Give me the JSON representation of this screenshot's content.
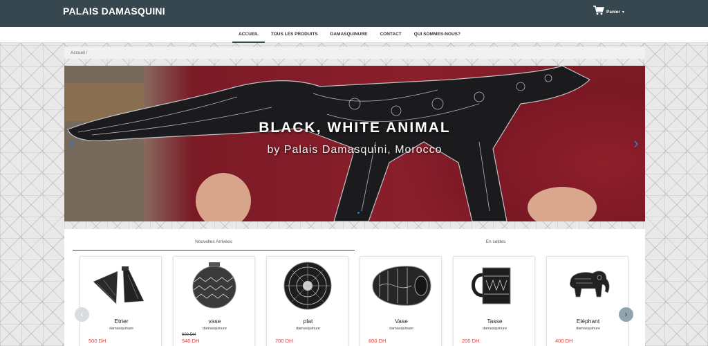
{
  "header": {
    "brand": "PALAIS DAMASQUINI",
    "cart_label": "Panier",
    "cart_caret": "▾"
  },
  "nav": {
    "items": [
      {
        "label": "ACCUEIL",
        "active": true
      },
      {
        "label": "TOUS LES PRODUITS",
        "active": false
      },
      {
        "label": "DAMASQUINURE",
        "active": false
      },
      {
        "label": "CONTACT",
        "active": false
      },
      {
        "label": "QUI SOMMES-NOUS?",
        "active": false
      }
    ]
  },
  "breadcrumb": {
    "text": "Accueil  /"
  },
  "hero": {
    "title": "BLACK, WHITE ANIMAL",
    "subtitle": "by Palais Damasquini, Morocco",
    "prev_icon": "‹",
    "next_icon": "›"
  },
  "products": {
    "tabs": [
      {
        "label": "Nouvelles Arrivées",
        "active": true
      },
      {
        "label": "En soldes",
        "active": false
      }
    ],
    "items": [
      {
        "name": "Etrier",
        "category": "damasquinure",
        "old_price": "",
        "price": "500 DH",
        "icon": "stirrup-icon"
      },
      {
        "name": "vase",
        "category": "damasquinure",
        "old_price": "600 DH",
        "price": "540 DH",
        "icon": "round-vase-icon"
      },
      {
        "name": "plat",
        "category": "damasquinure",
        "old_price": "",
        "price": "700 DH",
        "icon": "plate-icon"
      },
      {
        "name": "Vase",
        "category": "damasquinure",
        "old_price": "",
        "price": "600 DH",
        "icon": "oval-vase-icon"
      },
      {
        "name": "Tasse",
        "category": "damasquinure",
        "old_price": "",
        "price": "200 DH",
        "icon": "mug-icon"
      },
      {
        "name": "Eléphant",
        "category": "damasquinure",
        "old_price": "",
        "price": "400 DH",
        "icon": "elephant-icon"
      }
    ],
    "prev_icon": "‹",
    "next_icon": "›"
  },
  "colors": {
    "header_bg": "#37474f",
    "price": "#e53935",
    "accent": "#2f7bd6"
  }
}
